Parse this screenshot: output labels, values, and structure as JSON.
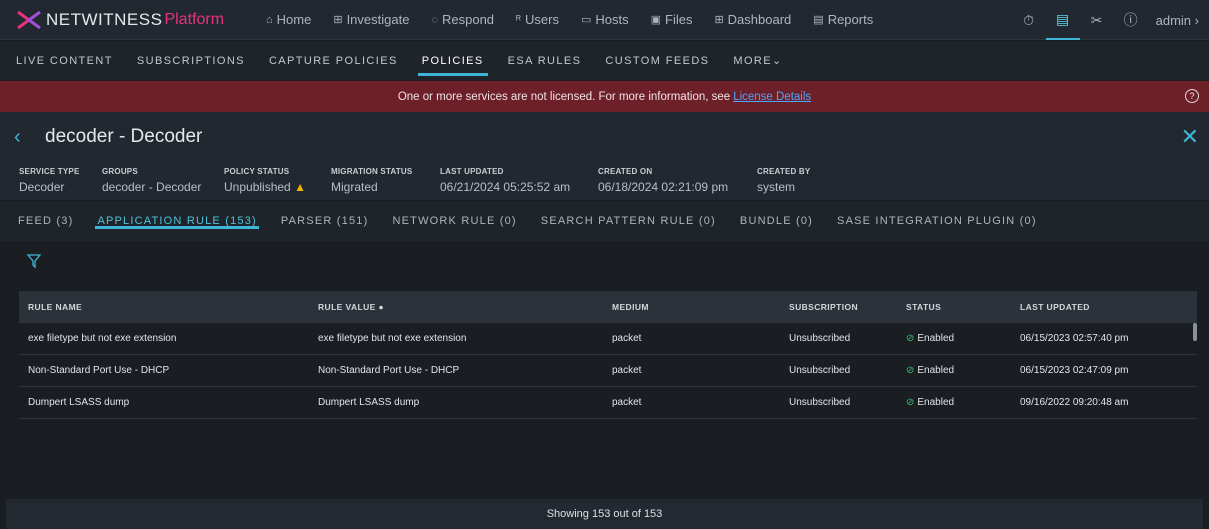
{
  "brand": {
    "name": "NETWITNESS",
    "platform": "Platform",
    "accent": "#e8317e",
    "primary": "#3fb6d6"
  },
  "nav": [
    {
      "label": "Home",
      "icon": "home-icon",
      "glyph": "⌂"
    },
    {
      "label": "Investigate",
      "icon": "investigate-icon",
      "glyph": "⊞"
    },
    {
      "label": "Respond",
      "icon": "respond-icon",
      "glyph": "◌"
    },
    {
      "label": "Users",
      "icon": "users-icon",
      "glyph": "ᴿ"
    },
    {
      "label": "Hosts",
      "icon": "hosts-icon",
      "glyph": "▭"
    },
    {
      "label": "Files",
      "icon": "files-icon",
      "glyph": "▣"
    },
    {
      "label": "Dashboard",
      "icon": "dashboard-icon",
      "glyph": "⊞"
    },
    {
      "label": "Reports",
      "icon": "reports-icon",
      "glyph": "▤"
    }
  ],
  "user": {
    "name": "admin"
  },
  "subnav": [
    "LIVE CONTENT",
    "SUBSCRIPTIONS",
    "CAPTURE POLICIES",
    "POLICIES",
    "ESA RULES",
    "CUSTOM FEEDS",
    "MORE"
  ],
  "subnav_active": "POLICIES",
  "banner": {
    "text": "One or more services are not licensed. For more information, see",
    "link": "License Details"
  },
  "page": {
    "title": "decoder - Decoder"
  },
  "meta": {
    "service_type": {
      "label": "SERVICE TYPE",
      "value": "Decoder"
    },
    "groups": {
      "label": "GROUPS",
      "value": "decoder - Decoder"
    },
    "policy_status": {
      "label": "POLICY STATUS",
      "value": "Unpublished"
    },
    "migration_status": {
      "label": "MIGRATION STATUS",
      "value": "Migrated"
    },
    "last_updated": {
      "label": "LAST UPDATED",
      "value": "06/21/2024 05:25:52 am"
    },
    "created_on": {
      "label": "CREATED ON",
      "value": "06/18/2024 02:21:09 pm"
    },
    "created_by": {
      "label": "CREATED BY",
      "value": "system"
    }
  },
  "tabs": [
    "FEED (3)",
    "APPLICATION RULE (153)",
    "PARSER (151)",
    "NETWORK RULE (0)",
    "SEARCH PATTERN RULE (0)",
    "BUNDLE (0)",
    "SASE INTEGRATION PLUGIN (0)"
  ],
  "tab_active": "APPLICATION RULE (153)",
  "table": {
    "headers": [
      "RULE NAME",
      "RULE VALUE",
      "MEDIUM",
      "SUBSCRIPTION",
      "STATUS",
      "LAST UPDATED"
    ],
    "rows": [
      [
        "exe filetype but not exe extension",
        "exe filetype but not exe extension",
        "packet",
        "Unsubscribed",
        "Enabled",
        "06/15/2023 02:57:40 pm"
      ],
      [
        "Non-Standard Port Use - DHCP",
        "Non-Standard Port Use - DHCP",
        "packet",
        "Unsubscribed",
        "Enabled",
        "06/15/2023 02:47:09 pm"
      ],
      [
        "Dumpert LSASS dump",
        "Dumpert LSASS dump",
        "packet",
        "Unsubscribed",
        "Enabled",
        "09/16/2022 09:20:48 am"
      ]
    ]
  },
  "footer": {
    "text": "Showing 153 out of 153"
  }
}
